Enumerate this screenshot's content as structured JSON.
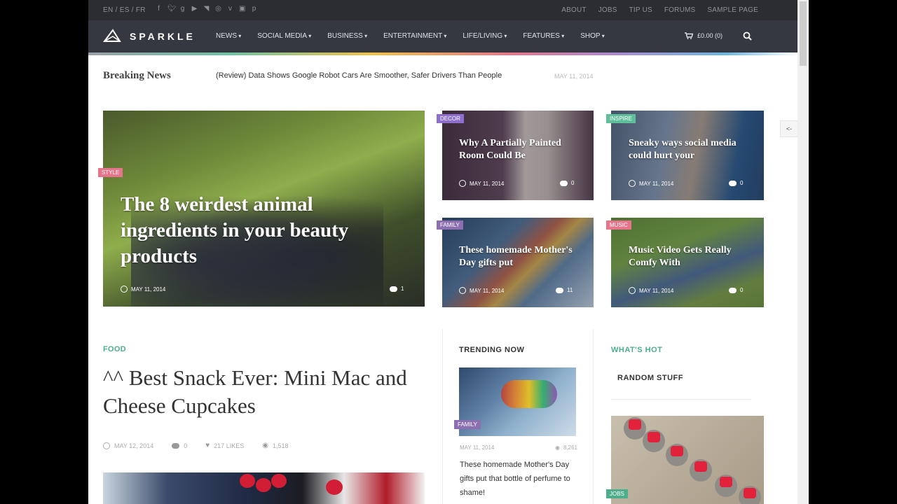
{
  "topbar": {
    "languages": "EN / ES / FR",
    "social_icons": [
      "facebook-icon",
      "twitter-icon",
      "google-plus-icon",
      "youtube-icon",
      "rss-icon",
      "dribbble-icon",
      "vimeo-icon",
      "instagram-icon",
      "pinterest-icon"
    ],
    "links": [
      "ABOUT",
      "JOBS",
      "TIP US",
      "FORUMS",
      "SAMPLE PAGE"
    ]
  },
  "nav": {
    "logo": "SPARKLE",
    "items": [
      "NEWS",
      "SOCIAL MEDIA",
      "BUSINESS",
      "ENTERTAINMENT",
      "LIFE/LIVING",
      "FEATURES",
      "SHOP"
    ],
    "cart": "£0.00 (0)"
  },
  "breaking": {
    "label": "Breaking News",
    "headline": "(Review) Data Shows Google Robot Cars Are Smoother, Safer Drivers Than People",
    "date": "MAY 11, 2014"
  },
  "side_tab": "<-",
  "featured": {
    "main": {
      "category": "STYLE",
      "title": "The 8 weirdest animal ingredients in your beauty products",
      "date": "MAY 11, 2014",
      "comments": "1"
    },
    "cards": [
      {
        "category": "DECOR",
        "title": "Why A Partially Painted Room Could Be",
        "date": "MAY 11, 2014",
        "comments": "0"
      },
      {
        "category": "INSPIRE",
        "title": "Sneaky ways social media could hurt your",
        "date": "MAY 11, 2014",
        "comments": "0"
      },
      {
        "category": "FAMILY",
        "title": "These homemade Mother's Day gifts put",
        "date": "MAY 11, 2014",
        "comments": "11"
      },
      {
        "category": "MUSIC",
        "title": "Music Video Gets Really Comfy With",
        "date": "MAY 11, 2014",
        "comments": "0"
      }
    ]
  },
  "article": {
    "category": "FOOD",
    "title": "^^ Best Snack Ever: Mini Mac and Cheese Cupcakes",
    "date": "MAY 12, 2014",
    "comments": "0",
    "likes": "217 LIKES",
    "views": "1,518"
  },
  "trending": {
    "title": "TRENDING NOW",
    "category": "FAMILY",
    "date": "MAY 11, 2014",
    "views": "8,261",
    "text": "These homemade Mother's Day gifts put that bottle of perfume to shame!"
  },
  "whats_hot": {
    "title": "WHAT'S HOT",
    "subtitle": "RANDOM STUFF",
    "category": "JOBS"
  },
  "colors": {
    "style": "#e8748c",
    "decor": "#8e6fd0",
    "inspire": "#5fbf9a",
    "family": "#8b6fb0",
    "music": "#e8748c",
    "jobs": "#4cae8a",
    "accent_green": "#4cae8a"
  }
}
